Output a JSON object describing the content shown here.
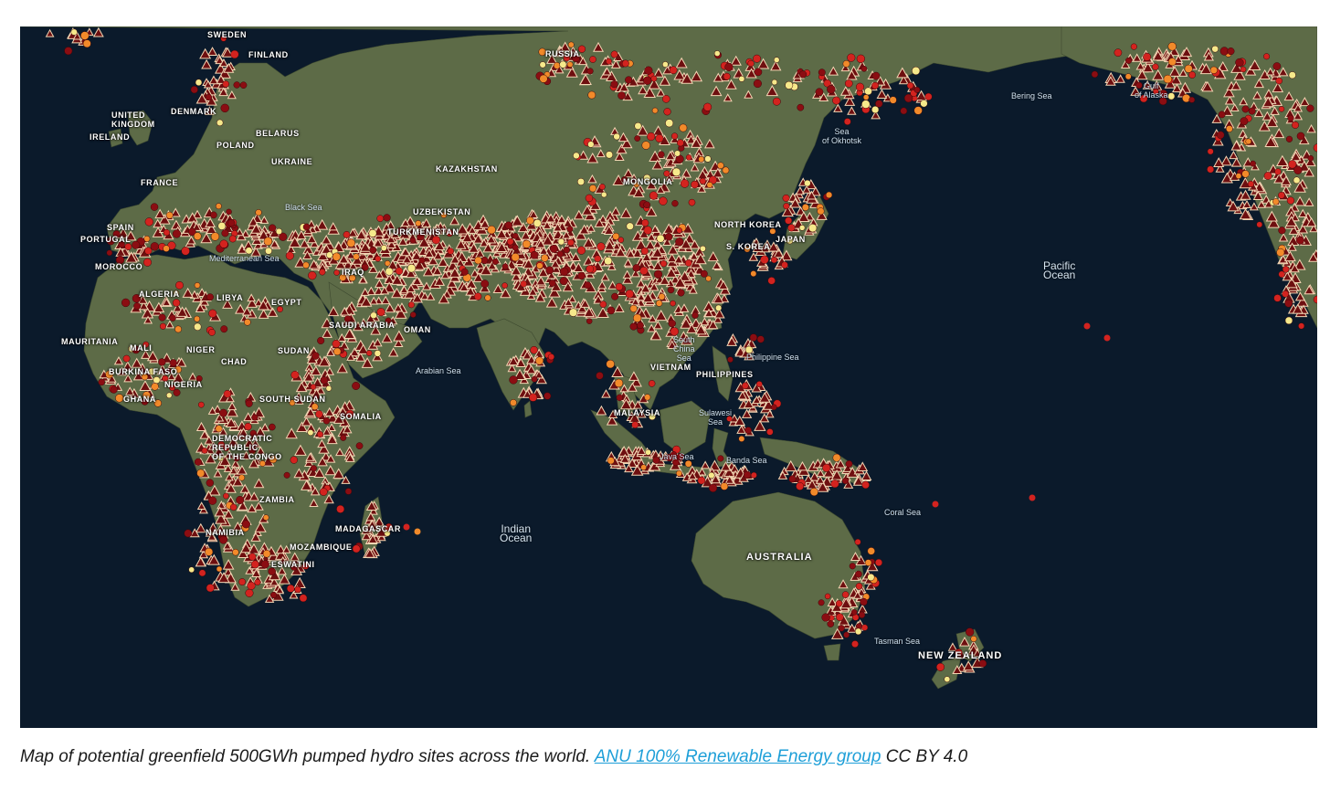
{
  "map": {
    "country_labels": [
      {
        "id": "sweden",
        "text": "SWEDEN"
      },
      {
        "id": "finland",
        "text": "FINLAND"
      },
      {
        "id": "russia",
        "text": "RUSSIA"
      },
      {
        "id": "united-kingdom",
        "text": "UNITED\nKINGDOM"
      },
      {
        "id": "denmark",
        "text": "DENMARK"
      },
      {
        "id": "ireland",
        "text": "IRELAND"
      },
      {
        "id": "belarus",
        "text": "BELARUS"
      },
      {
        "id": "poland",
        "text": "POLAND"
      },
      {
        "id": "ukraine",
        "text": "UKRAINE"
      },
      {
        "id": "kazakhstan",
        "text": "KAZAKHSTAN"
      },
      {
        "id": "france",
        "text": "FRANCE"
      },
      {
        "id": "mongolia",
        "text": "MONGOLIA"
      },
      {
        "id": "uzbekistan",
        "text": "UZBEKISTAN"
      },
      {
        "id": "turkmenistan",
        "text": "TURKMENISTAN"
      },
      {
        "id": "portugal",
        "text": "PORTUGAL"
      },
      {
        "id": "spain",
        "text": "SPAIN"
      },
      {
        "id": "north-korea",
        "text": "NORTH KOREA"
      },
      {
        "id": "south-korea",
        "text": "S. KOREA"
      },
      {
        "id": "japan",
        "text": "JAPAN"
      },
      {
        "id": "iraq",
        "text": "IRAQ"
      },
      {
        "id": "morocco",
        "text": "MOROCCO"
      },
      {
        "id": "algeria",
        "text": "ALGERIA"
      },
      {
        "id": "libya",
        "text": "LIBYA"
      },
      {
        "id": "egypt",
        "text": "EGYPT"
      },
      {
        "id": "saudi-arabia",
        "text": "SAUDI ARABIA"
      },
      {
        "id": "oman",
        "text": "OMAN"
      },
      {
        "id": "mauritania",
        "text": "MAURITANIA"
      },
      {
        "id": "mali",
        "text": "MALI"
      },
      {
        "id": "niger",
        "text": "NIGER"
      },
      {
        "id": "sudan",
        "text": "SUDAN"
      },
      {
        "id": "chad",
        "text": "CHAD"
      },
      {
        "id": "burkina-faso",
        "text": "BURKINA FASO"
      },
      {
        "id": "nigeria",
        "text": "NIGERIA"
      },
      {
        "id": "ghana",
        "text": "GHANA"
      },
      {
        "id": "south-sudan",
        "text": "SOUTH SUDAN"
      },
      {
        "id": "somalia",
        "text": "SOMALIA"
      },
      {
        "id": "vietnam",
        "text": "VIETNAM"
      },
      {
        "id": "philippines",
        "text": "PHILIPPINES"
      },
      {
        "id": "malaysia",
        "text": "MALAYSIA"
      },
      {
        "id": "drc",
        "text": "DEMOCRATIC\nREPUBLIC\nOF THE CONGO"
      },
      {
        "id": "zambia",
        "text": "ZAMBIA"
      },
      {
        "id": "namibia",
        "text": "NAMIBIA"
      },
      {
        "id": "mozambique",
        "text": "MOZAMBIQUE"
      },
      {
        "id": "madagascar",
        "text": "MADAGASCAR"
      },
      {
        "id": "eswatini",
        "text": "ESWATINI"
      },
      {
        "id": "australia",
        "text": "AUSTRALIA"
      },
      {
        "id": "new-zealand",
        "text": "NEW ZEALAND"
      }
    ],
    "sea_labels": [
      {
        "id": "bering-sea",
        "text": "Bering Sea"
      },
      {
        "id": "gulf-of-alaska",
        "text": "Gulf\nof Alaska"
      },
      {
        "id": "sea-of-okhotsk",
        "text": "Sea\nof Okhotsk"
      },
      {
        "id": "black-sea",
        "text": "Black Sea"
      },
      {
        "id": "mediterranean-sea",
        "text": "Mediterranean Sea"
      },
      {
        "id": "arabian-sea",
        "text": "Arabian Sea"
      },
      {
        "id": "south-china-sea",
        "text": "South\nChina\nSea"
      },
      {
        "id": "philippine-sea",
        "text": "Philippine Sea"
      },
      {
        "id": "sulawesi-sea",
        "text": "Sulawesi\nSea"
      },
      {
        "id": "java-sea",
        "text": "Java Sea"
      },
      {
        "id": "banda-sea",
        "text": "Banda Sea"
      },
      {
        "id": "coral-sea",
        "text": "Coral Sea"
      },
      {
        "id": "tasman-sea",
        "text": "Tasman Sea"
      }
    ],
    "ocean_labels": [
      {
        "id": "pacific-ocean",
        "text": "Pacific\nOcean"
      },
      {
        "id": "indian-ocean",
        "text": "Indian\nOcean"
      }
    ],
    "colors": {
      "ocean": "#0b1a2b",
      "land": "#5d6b47",
      "site_triangle_fill": "#6e0f10",
      "site_triangle_stroke": "#f3d6b4",
      "dot_dark_red": "#8b0d12",
      "dot_red": "#d3231f",
      "dot_orange": "#f28a2a",
      "dot_yellow": "#f6e98b"
    }
  },
  "caption": {
    "text": "Map of potential greenfield 500GWh pumped hydro sites across the world.",
    "link_text": "ANU 100% Renewable Energy group",
    "license": "CC BY 4.0"
  }
}
